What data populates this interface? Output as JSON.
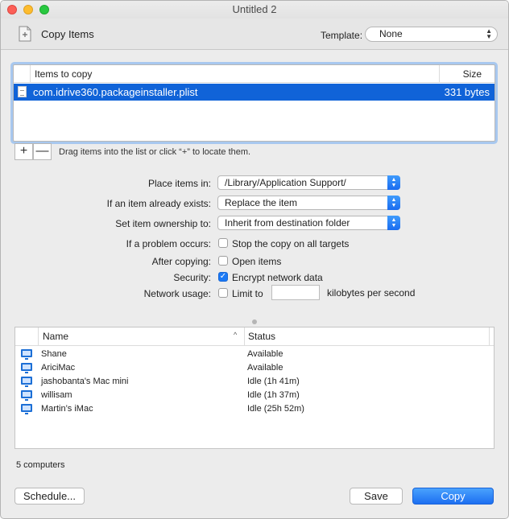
{
  "window": {
    "title": "Untitled 2"
  },
  "toolbar": {
    "task_title": "Copy Items",
    "template_label": "Template:",
    "template_value": "None"
  },
  "items_table": {
    "columns": {
      "name": "Items to copy",
      "size": "Size"
    },
    "rows": [
      {
        "name": "com.idrive360.packageinstaller.plist",
        "size": "331 bytes"
      }
    ],
    "add_label": "+",
    "remove_label": "—",
    "hint": "Drag items into the list or click “+” to locate them."
  },
  "form": {
    "place_label": "Place items in:",
    "place_value": "/Library/Application Support/",
    "exists_label": "If an item already exists:",
    "exists_value": "Replace the item",
    "ownership_label": "Set item ownership to:",
    "ownership_value": "Inherit from destination folder",
    "problem_label": "If a problem occurs:",
    "problem_option": "Stop the copy on all targets",
    "problem_checked": false,
    "after_label": "After copying:",
    "after_option": "Open items",
    "after_checked": false,
    "security_label": "Security:",
    "security_option": "Encrypt network data",
    "security_checked": true,
    "network_label": "Network usage:",
    "network_option": "Limit to",
    "network_checked": false,
    "network_value": "",
    "network_unit": "kilobytes per second"
  },
  "computers": {
    "columns": {
      "name": "Name",
      "status": "Status"
    },
    "rows": [
      {
        "name": "Shane",
        "status": "Available"
      },
      {
        "name": "AriciMac",
        "status": "Available"
      },
      {
        "name": "jashobanta's Mac mini",
        "status": "Idle (1h 41m)"
      },
      {
        "name": "willisam",
        "status": "Idle (1h 37m)"
      },
      {
        "name": "Martin’s iMac",
        "status": "Idle (25h 52m)"
      }
    ],
    "count": "5 computers"
  },
  "buttons": {
    "schedule": "Schedule...",
    "save": "Save",
    "copy": "Copy"
  },
  "colors": {
    "selection": "#1063d8",
    "accent": "#1a79f5"
  }
}
